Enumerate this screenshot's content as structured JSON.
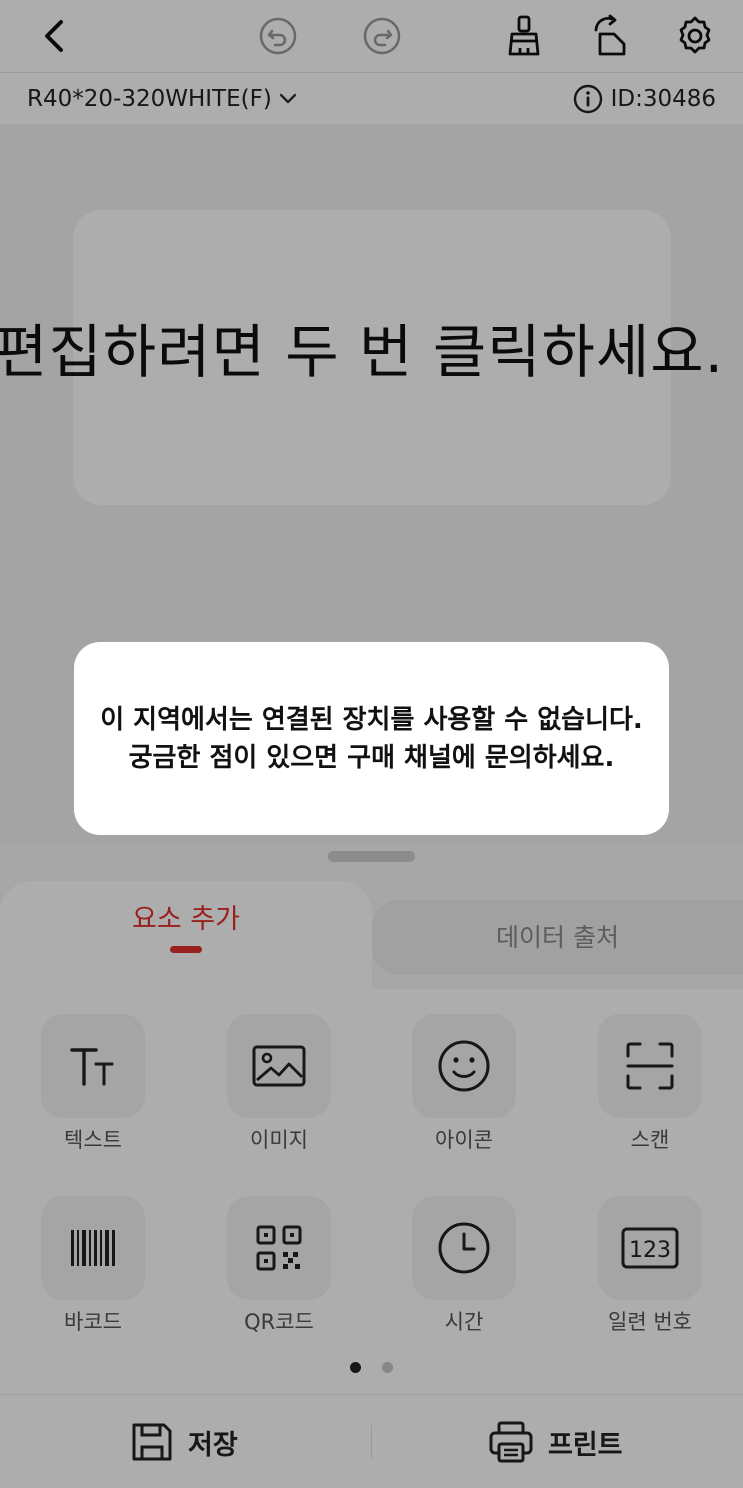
{
  "label_bar": {
    "label_name": "R40*20-320WHITE(F)",
    "label_id": "ID:30486"
  },
  "canvas": {
    "placeholder_text": "편집하려면 두 번 클릭하세요."
  },
  "tabs": {
    "active": "요소 추가",
    "inactive": "데이터 출처"
  },
  "tools": [
    {
      "label": "텍스트",
      "icon": "text-size-icon"
    },
    {
      "label": "이미지",
      "icon": "image-icon"
    },
    {
      "label": "아이콘",
      "icon": "smiley-icon"
    },
    {
      "label": "스캔",
      "icon": "scan-icon"
    },
    {
      "label": "바코드",
      "icon": "barcode-icon"
    },
    {
      "label": "QR코드",
      "icon": "qr-code-icon"
    },
    {
      "label": "시간",
      "icon": "clock-icon"
    },
    {
      "label": "일련 번호",
      "icon": "serial-number-icon"
    }
  ],
  "pager": {
    "pages": 2,
    "current": 1
  },
  "actions": {
    "save": "저장",
    "print": "프린트"
  },
  "dialog": {
    "message": "이 지역에서는 연결된 장치를 사용할 수 없습니다. 궁금한 점이 있으면 구매 채널에 문의하세요."
  },
  "colors": {
    "accent": "#e0312e",
    "overlay": "rgba(0,0,0,0.32)",
    "dot_active": "#222222",
    "dot_inactive": "#c8c8c8"
  }
}
